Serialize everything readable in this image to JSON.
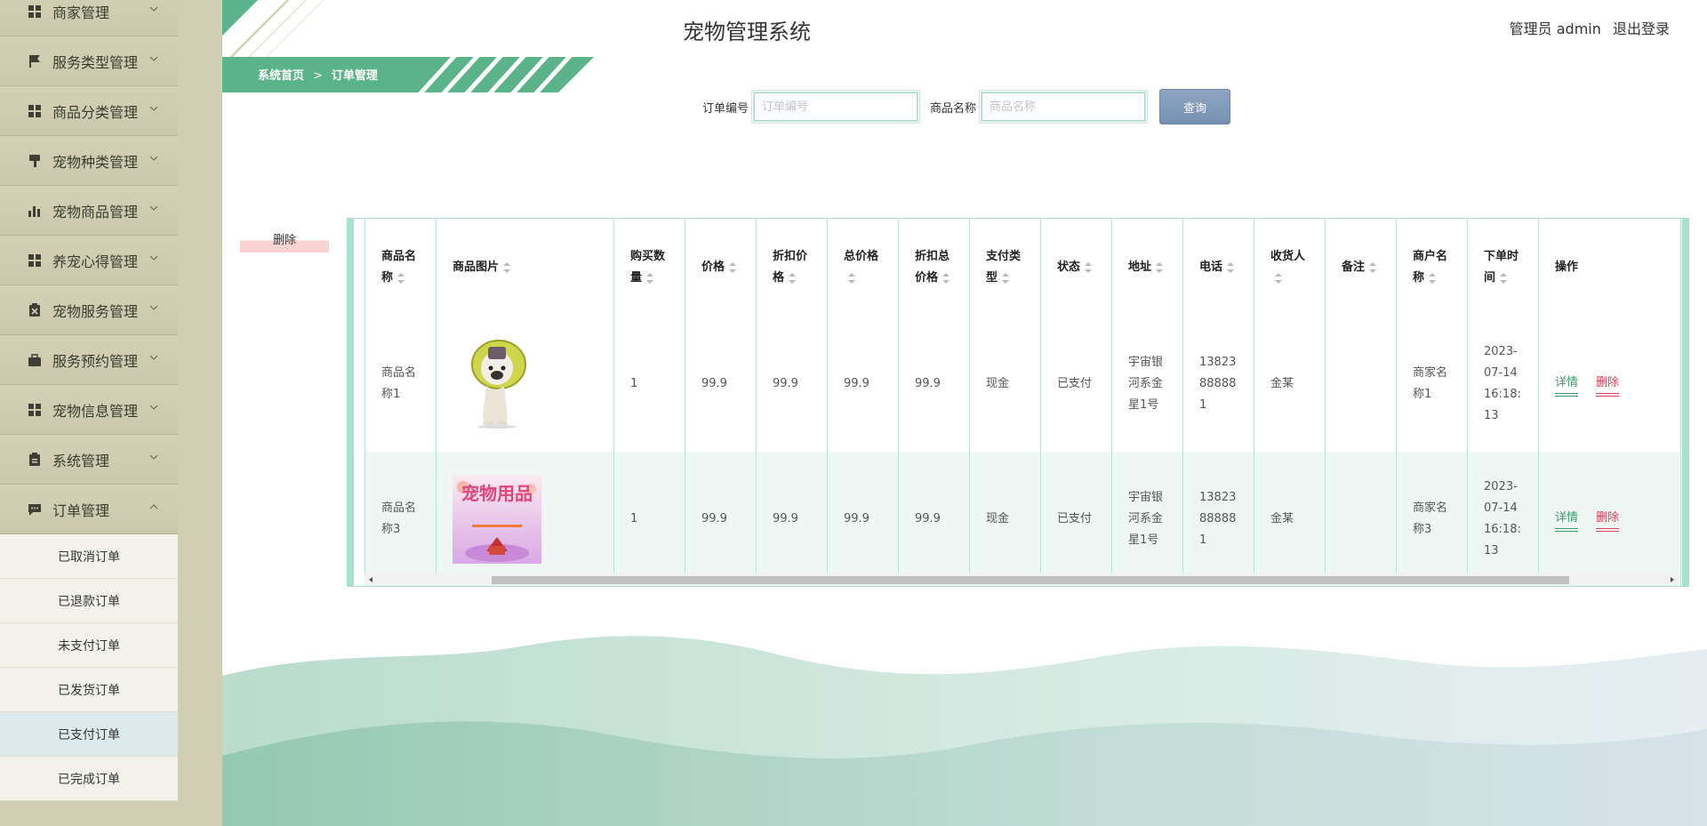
{
  "app": {
    "title": "宠物管理系统",
    "user_label": "管理员 admin",
    "logout_label": "退出登录"
  },
  "breadcrumb": {
    "home": "系统首页",
    "separator": ">",
    "current": "订单管理"
  },
  "sidebar": {
    "items": [
      {
        "label": "商家管理",
        "icon": "grid-icon"
      },
      {
        "label": "服务类型管理",
        "icon": "flag-icon"
      },
      {
        "label": "商品分类管理",
        "icon": "grid-icon"
      },
      {
        "label": "宠物种类管理",
        "icon": "brush-icon"
      },
      {
        "label": "宠物商品管理",
        "icon": "bar-chart-icon"
      },
      {
        "label": "养宠心得管理",
        "icon": "grid-icon"
      },
      {
        "label": "宠物服务管理",
        "icon": "clipboard-x-icon"
      },
      {
        "label": "服务预约管理",
        "icon": "briefcase-icon"
      },
      {
        "label": "宠物信息管理",
        "icon": "grid-icon"
      },
      {
        "label": "系统管理",
        "icon": "clipboard-icon"
      },
      {
        "label": "订单管理",
        "icon": "chat-icon"
      }
    ],
    "submenu": [
      "已取消订单",
      "已退款订单",
      "未支付订单",
      "已发货订单",
      "已支付订单",
      "已完成订单"
    ],
    "active_submenu": "已支付订单"
  },
  "search": {
    "order_no_label": "订单编号",
    "order_no_placeholder": "订单编号",
    "goods_name_label": "商品名称",
    "goods_name_placeholder": "商品名称",
    "query_label": "查询"
  },
  "batch_delete_label": "删除",
  "table": {
    "headers": {
      "name": "商品名称",
      "image": "商品图片",
      "qty": "购买数量",
      "price": "价格",
      "discount_price": "折扣价格",
      "total": "总价格",
      "discount_total": "折扣总价格",
      "pay_type": "支付类型",
      "status": "状态",
      "address": "地址",
      "phone": "电话",
      "receiver": "收货人",
      "remark": "备注",
      "merchant": "商户名称",
      "order_time": "下单时间",
      "actions": "操作"
    },
    "rows": [
      {
        "name": "商品名称1",
        "image": "french-bulldog-photo",
        "qty": "1",
        "price": "99.9",
        "discount_price": "99.9",
        "total": "99.9",
        "discount_total": "99.9",
        "pay_type": "现金",
        "status": "已支付",
        "address": "宇宙银河系金星1号",
        "phone": "13823888881",
        "receiver": "金某",
        "remark": "",
        "merchant": "商家名称1",
        "order_time": "2023-07-14 16:18:13"
      },
      {
        "name": "商品名称3",
        "image": "pet-supplies-poster",
        "image_text": "宠物用品",
        "qty": "1",
        "price": "99.9",
        "discount_price": "99.9",
        "total": "99.9",
        "discount_total": "99.9",
        "pay_type": "现金",
        "status": "已支付",
        "address": "宇宙银河系金星1号",
        "phone": "13823888881",
        "receiver": "金某",
        "remark": "",
        "merchant": "商家名称3",
        "order_time": "2023-07-14 16:18:13"
      }
    ],
    "action_detail": "详情",
    "action_delete": "删除"
  },
  "colors": {
    "accent_green": "#5bb38a",
    "sidebar_bg": "#d0cfb4",
    "table_border": "#a8e2cc",
    "query_button": "#7f99b8",
    "delete_red": "#e0445a"
  }
}
